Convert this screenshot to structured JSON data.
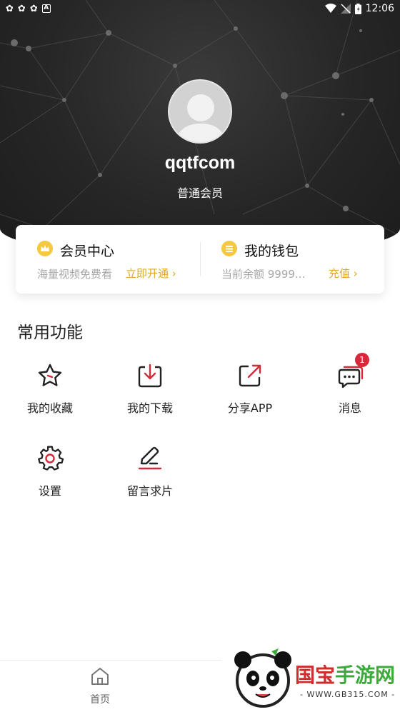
{
  "statusbar": {
    "time": "12:06",
    "badge_letter": "A",
    "left_icons": [
      "bug-icon",
      "bug-icon",
      "bug-icon"
    ]
  },
  "profile": {
    "username": "qqtfcom",
    "level": "普通会员"
  },
  "member_card": {
    "vip": {
      "title": "会员中心",
      "subtitle": "海量视频免费看",
      "action": "立即开通"
    },
    "wallet": {
      "title": "我的钱包",
      "subtitle": "当前余额 9999...",
      "action": "充值"
    }
  },
  "features": {
    "title": "常用功能",
    "items": [
      {
        "label": "我的收藏",
        "icon": "star-icon"
      },
      {
        "label": "我的下载",
        "icon": "download-icon"
      },
      {
        "label": "分享APP",
        "icon": "share-icon"
      },
      {
        "label": "消息",
        "icon": "message-icon",
        "badge": "1"
      },
      {
        "label": "设置",
        "icon": "gear-icon"
      },
      {
        "label": "留言求片",
        "icon": "edit-icon"
      }
    ]
  },
  "tabbar": {
    "home_label": "首页"
  },
  "watermark": {
    "text_red": "国宝",
    "text_green": "手游网",
    "url": "- WWW.GB315.COM -"
  },
  "colors": {
    "accent_gold": "#e0a726",
    "accent_red": "#d6293a",
    "header_dark": "#262626"
  }
}
